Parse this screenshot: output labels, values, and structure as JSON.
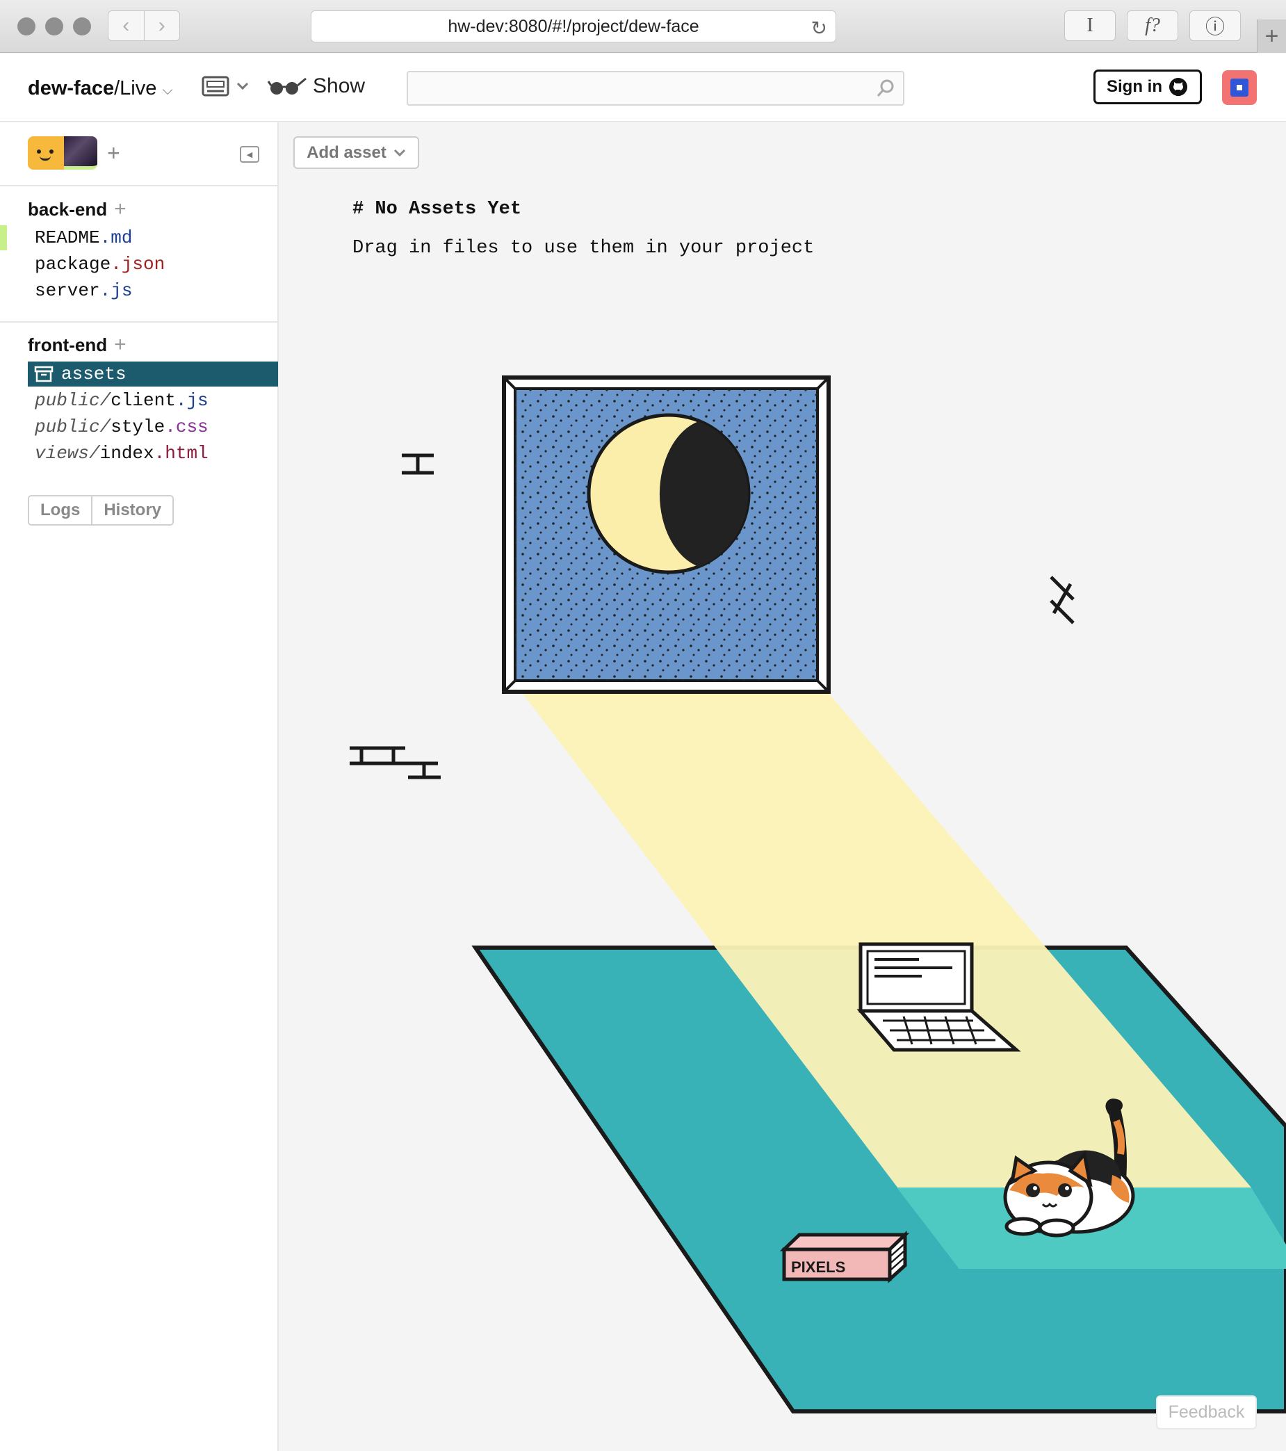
{
  "browser": {
    "url": "hw-dev:8080/#!/project/dew-face",
    "toolbar_buttons": [
      "I",
      "f?",
      "ⓘ"
    ]
  },
  "header": {
    "project_name": "dew-face",
    "project_suffix": "/Live",
    "show_label": "Show",
    "search_value": "",
    "sign_in_label": "Sign in"
  },
  "sidebar": {
    "sections": [
      {
        "title": "back-end",
        "files": [
          {
            "dir": "",
            "name": "README",
            "ext": ".md"
          },
          {
            "dir": "",
            "name": "package",
            "ext": ".json"
          },
          {
            "dir": "",
            "name": "server",
            "ext": ".js"
          }
        ]
      },
      {
        "title": "front-end",
        "files": [
          {
            "dir": "",
            "name": "assets",
            "ext": ""
          },
          {
            "dir": "public/",
            "name": "client",
            "ext": ".js"
          },
          {
            "dir": "public/",
            "name": "style",
            "ext": ".css"
          },
          {
            "dir": "views/",
            "name": "index",
            "ext": ".html"
          }
        ]
      }
    ],
    "tabs": [
      "Logs",
      "History"
    ]
  },
  "main": {
    "add_asset_label": "Add asset",
    "title": "# No Assets Yet",
    "body": "Drag in files to use them in your project",
    "box_label": "PIXELS"
  },
  "feedback_label": "Feedback",
  "colors": {
    "selected": "#1c5a6e",
    "rug": "#38b2b7",
    "sky": "#6b96cc",
    "moonlight": "#fbf2b6"
  }
}
